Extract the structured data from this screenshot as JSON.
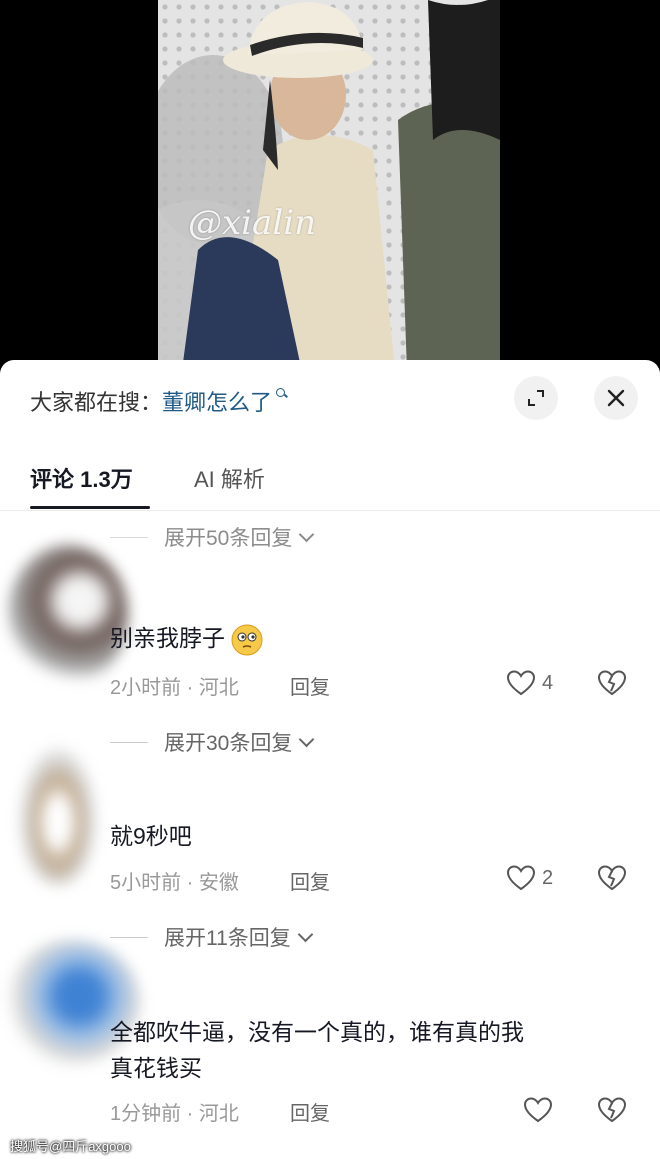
{
  "video": {
    "watermark": "@xialin"
  },
  "search": {
    "prefix": "大家都在搜：",
    "keyword": "董卿怎么了"
  },
  "tabs": [
    {
      "label": "评论 1.3万",
      "active": true
    },
    {
      "label": "AI 解析",
      "active": false
    }
  ],
  "expand_top": "展开50条回复",
  "comments": [
    {
      "text": "别亲我脖子",
      "emoji": "thinking-face",
      "meta": "2小时前 · 河北",
      "reply": "回复",
      "likes": "4",
      "expand": "展开30条回复"
    },
    {
      "text": "就9秒吧",
      "meta": "5小时前 · 安徽",
      "reply": "回复",
      "likes": "2",
      "expand": "展开11条回复"
    },
    {
      "text_line1": "全都吹牛逼，没有一个真的，谁有真的我",
      "text_line2": "真花钱买",
      "meta": "1分钟前 · 河北",
      "reply": "回复",
      "likes": ""
    }
  ],
  "footer": {
    "watermark": "搜狐号@四斤axgooo"
  },
  "colors": {
    "search_keyword": "#1f5b86",
    "text_primary": "#161823",
    "meta": "#999999"
  }
}
